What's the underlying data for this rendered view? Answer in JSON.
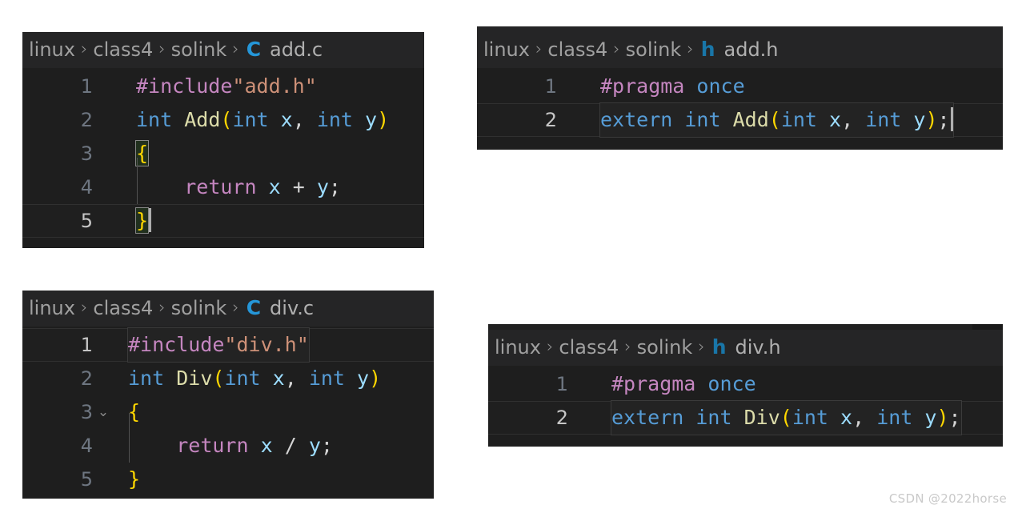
{
  "watermark": "CSDN @2022horse",
  "breadcrumb_separator": "›",
  "panels": [
    {
      "id": "add-c",
      "breadcrumb": {
        "crumbs": [
          "linux",
          "class4",
          "solink"
        ],
        "icon": "c-file-icon",
        "icon_glyph": "C",
        "icon_color": "#2596d8",
        "filename": "add.c"
      },
      "lines": [
        {
          "no": "1",
          "active": false,
          "fold": "",
          "tokens": [
            {
              "t": "#include",
              "c": "t-pre"
            },
            {
              "t": "\"add.h\"",
              "c": "t-str"
            }
          ]
        },
        {
          "no": "2",
          "active": false,
          "fold": "",
          "tokens": [
            {
              "t": "int",
              "c": "t-kw"
            },
            {
              "t": " ",
              "c": "t-op"
            },
            {
              "t": "Add",
              "c": "t-fn"
            },
            {
              "t": "(",
              "c": "t-par"
            },
            {
              "t": "int",
              "c": "t-kw"
            },
            {
              "t": " ",
              "c": "t-op"
            },
            {
              "t": "x",
              "c": "t-var"
            },
            {
              "t": ", ",
              "c": "t-op"
            },
            {
              "t": "int",
              "c": "t-kw"
            },
            {
              "t": " ",
              "c": "t-op"
            },
            {
              "t": "y",
              "c": "t-var"
            },
            {
              "t": ")",
              "c": "t-par"
            }
          ]
        },
        {
          "no": "3",
          "active": false,
          "fold": "",
          "tokens": [
            {
              "t": "{",
              "c": "t-brace",
              "box": true
            }
          ]
        },
        {
          "no": "4",
          "active": false,
          "fold": "",
          "tokens": [
            {
              "t": "    ",
              "c": "t-op"
            },
            {
              "t": "return",
              "c": "t-ctl"
            },
            {
              "t": " ",
              "c": "t-op"
            },
            {
              "t": "x",
              "c": "t-var"
            },
            {
              "t": " + ",
              "c": "t-op"
            },
            {
              "t": "y",
              "c": "t-var"
            },
            {
              "t": ";",
              "c": "t-op"
            }
          ]
        },
        {
          "no": "5",
          "active": true,
          "fold": "",
          "caret": true,
          "tokens": [
            {
              "t": "}",
              "c": "t-brace",
              "box": true
            }
          ]
        }
      ]
    },
    {
      "id": "add-h",
      "breadcrumb": {
        "crumbs": [
          "linux",
          "class4",
          "solink"
        ],
        "icon": "h-file-icon",
        "icon_glyph": "h",
        "icon_color": "#1976a8",
        "filename": "add.h"
      },
      "lines": [
        {
          "no": "1",
          "active": false,
          "fold": "",
          "tokens": [
            {
              "t": "#pragma",
              "c": "t-pre"
            },
            {
              "t": " ",
              "c": "t-op"
            },
            {
              "t": "once",
              "c": "t-kw"
            }
          ]
        },
        {
          "no": "2",
          "active": true,
          "fold": "",
          "caret": true,
          "linebox": true,
          "tokens": [
            {
              "t": "extern",
              "c": "t-kw"
            },
            {
              "t": " ",
              "c": "t-op"
            },
            {
              "t": "int",
              "c": "t-kw"
            },
            {
              "t": " ",
              "c": "t-op"
            },
            {
              "t": "Add",
              "c": "t-fn"
            },
            {
              "t": "(",
              "c": "t-par"
            },
            {
              "t": "int",
              "c": "t-kw"
            },
            {
              "t": " ",
              "c": "t-op"
            },
            {
              "t": "x",
              "c": "t-var"
            },
            {
              "t": ", ",
              "c": "t-op"
            },
            {
              "t": "int",
              "c": "t-kw"
            },
            {
              "t": " ",
              "c": "t-op"
            },
            {
              "t": "y",
              "c": "t-var"
            },
            {
              "t": ")",
              "c": "t-par"
            },
            {
              "t": ";",
              "c": "t-op"
            }
          ]
        }
      ]
    },
    {
      "id": "div-c",
      "breadcrumb": {
        "crumbs": [
          "linux",
          "class4",
          "solink"
        ],
        "icon": "c-file-icon",
        "icon_glyph": "C",
        "icon_color": "#2596d8",
        "filename": "div.c"
      },
      "lines": [
        {
          "no": "1",
          "active": true,
          "fold": "",
          "linebox": true,
          "tokens": [
            {
              "t": "#include",
              "c": "t-pre"
            },
            {
              "t": "\"div.h\"",
              "c": "t-str"
            }
          ]
        },
        {
          "no": "2",
          "active": false,
          "fold": "",
          "tokens": [
            {
              "t": "int",
              "c": "t-kw"
            },
            {
              "t": " ",
              "c": "t-op"
            },
            {
              "t": "Div",
              "c": "t-fn"
            },
            {
              "t": "(",
              "c": "t-par"
            },
            {
              "t": "int",
              "c": "t-kw"
            },
            {
              "t": " ",
              "c": "t-op"
            },
            {
              "t": "x",
              "c": "t-var"
            },
            {
              "t": ", ",
              "c": "t-op"
            },
            {
              "t": "int",
              "c": "t-kw"
            },
            {
              "t": " ",
              "c": "t-op"
            },
            {
              "t": "y",
              "c": "t-var"
            },
            {
              "t": ")",
              "c": "t-par"
            }
          ]
        },
        {
          "no": "3",
          "active": false,
          "fold": "chevron-down",
          "tokens": [
            {
              "t": "{",
              "c": "t-brace"
            }
          ]
        },
        {
          "no": "4",
          "active": false,
          "fold": "",
          "indent_guide": true,
          "tokens": [
            {
              "t": "    ",
              "c": "t-op"
            },
            {
              "t": "return",
              "c": "t-ctl"
            },
            {
              "t": " ",
              "c": "t-op"
            },
            {
              "t": "x",
              "c": "t-var"
            },
            {
              "t": " / ",
              "c": "t-op"
            },
            {
              "t": "y",
              "c": "t-var"
            },
            {
              "t": ";",
              "c": "t-op"
            }
          ]
        },
        {
          "no": "5",
          "active": false,
          "fold": "",
          "tokens": [
            {
              "t": "}",
              "c": "t-brace"
            }
          ]
        }
      ]
    },
    {
      "id": "div-h",
      "breadcrumb": {
        "crumbs": [
          "linux",
          "class4",
          "solink"
        ],
        "icon": "h-file-icon",
        "icon_glyph": "h",
        "icon_color": "#1976a8",
        "filename": "div.h"
      },
      "lines": [
        {
          "no": "1",
          "active": false,
          "fold": "",
          "tokens": [
            {
              "t": "#pragma",
              "c": "t-pre"
            },
            {
              "t": " ",
              "c": "t-op"
            },
            {
              "t": "once",
              "c": "t-kw"
            }
          ]
        },
        {
          "no": "2",
          "active": true,
          "fold": "",
          "linebox": true,
          "tokens": [
            {
              "t": "extern",
              "c": "t-kw"
            },
            {
              "t": " ",
              "c": "t-op"
            },
            {
              "t": "int",
              "c": "t-kw"
            },
            {
              "t": " ",
              "c": "t-op"
            },
            {
              "t": "Div",
              "c": "t-fn"
            },
            {
              "t": "(",
              "c": "t-par"
            },
            {
              "t": "int",
              "c": "t-kw"
            },
            {
              "t": " ",
              "c": "t-op"
            },
            {
              "t": "x",
              "c": "t-var"
            },
            {
              "t": ", ",
              "c": "t-op"
            },
            {
              "t": "int",
              "c": "t-kw"
            },
            {
              "t": " ",
              "c": "t-op"
            },
            {
              "t": "y",
              "c": "t-var"
            },
            {
              "t": ")",
              "c": "t-par"
            },
            {
              "t": ";",
              "c": "t-op"
            }
          ]
        }
      ]
    }
  ]
}
